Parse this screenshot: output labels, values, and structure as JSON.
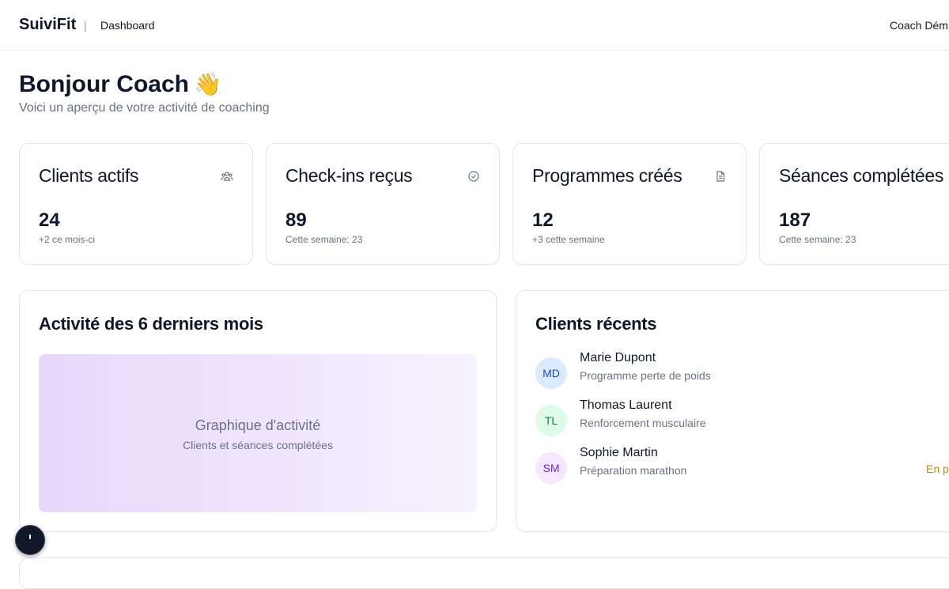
{
  "header": {
    "brand": "SuiviFit",
    "separator": "|",
    "breadcrumb": "Dashboard",
    "user": "Coach Dém"
  },
  "greeting": {
    "title": "Bonjour Coach",
    "emoji": "👋",
    "subtitle": "Voici un aperçu de votre activité de coaching"
  },
  "stats": [
    {
      "title": "Clients actifs",
      "icon": "users-icon",
      "value": "24",
      "note": "+2 ce mois-ci"
    },
    {
      "title": "Check-ins reçus",
      "icon": "check-circle-icon",
      "value": "89",
      "note": "Cette semaine: 23"
    },
    {
      "title": "Programmes créés",
      "icon": "document-icon",
      "value": "12",
      "note": "+3 cette semaine"
    },
    {
      "title": "Séances complétées",
      "icon": "activity-icon",
      "value": "187",
      "note": "Cette semaine: 23"
    }
  ],
  "activity": {
    "title": "Activité des 6 derniers mois",
    "placeholder_title": "Graphique d'activité",
    "placeholder_subtitle": "Clients et séances complétées"
  },
  "recent_clients": {
    "title": "Clients récents",
    "items": [
      {
        "initials": "MD",
        "name": "Marie Dupont",
        "program": "Programme perte de poids",
        "status": "",
        "avatar_bg": "#dbeafe",
        "avatar_fg": "#1d4ed8"
      },
      {
        "initials": "TL",
        "name": "Thomas Laurent",
        "program": "Renforcement musculaire",
        "status": "",
        "avatar_bg": "#dcfce7",
        "avatar_fg": "#15803d"
      },
      {
        "initials": "SM",
        "name": "Sophie Martin",
        "program": "Préparation marathon",
        "status": "En p",
        "avatar_bg": "#f3e8ff",
        "avatar_fg": "#7e22ce"
      }
    ]
  },
  "colors": {
    "accent_purple": "#e6d7fb",
    "status_pending": "#ca8a04",
    "border": "#e5e7eb"
  }
}
